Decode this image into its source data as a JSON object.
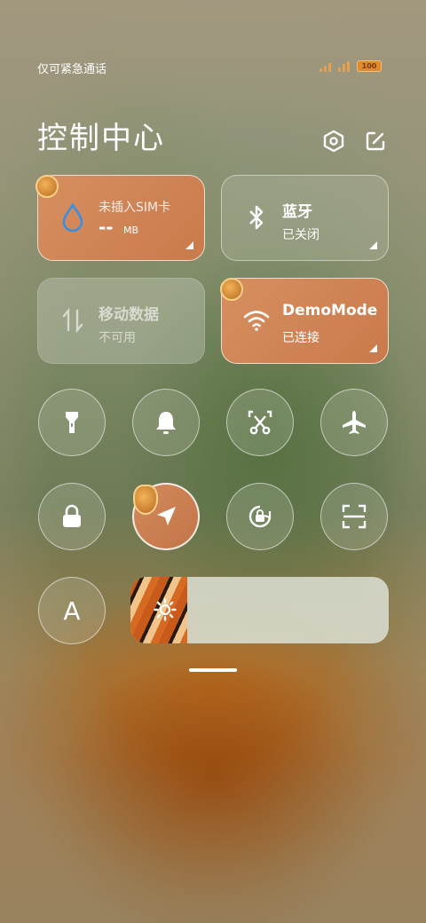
{
  "status_bar": {
    "carrier_text": "仅可紧急通话",
    "battery_label": "100"
  },
  "header": {
    "title": "控制中心",
    "settings_icon": "hexagon-settings-icon",
    "edit_icon": "edit-square-icon"
  },
  "tiles": {
    "data_usage": {
      "name": "未插入SIM卡",
      "value": "--",
      "unit": "MB",
      "icon": "water-drop-icon"
    },
    "bluetooth": {
      "name": "蓝牙",
      "status": "已关闭",
      "icon": "bluetooth-icon"
    },
    "mobile_data": {
      "name": "移动数据",
      "status": "不可用",
      "icon": "data-arrows-icon"
    },
    "wifi": {
      "name": "DemoMode",
      "status": "已连接",
      "icon": "wifi-icon"
    }
  },
  "toggles": [
    {
      "name": "flashlight",
      "icon": "flashlight-icon",
      "active": false
    },
    {
      "name": "ringer",
      "icon": "bell-icon",
      "active": false
    },
    {
      "name": "screenshot",
      "icon": "scissors-icon",
      "active": false
    },
    {
      "name": "airplane-mode",
      "icon": "airplane-icon",
      "active": false
    },
    {
      "name": "lock-screen",
      "icon": "lock-icon",
      "active": false
    },
    {
      "name": "location",
      "icon": "location-arrow-icon",
      "active": true
    },
    {
      "name": "rotation-lock",
      "icon": "rotation-lock-icon",
      "active": false
    },
    {
      "name": "scan",
      "icon": "scan-icon",
      "active": false
    },
    {
      "name": "auto-brightness",
      "icon": "letter-a-icon",
      "label": "A",
      "active": false
    }
  ],
  "brightness": {
    "level": 0.22,
    "icon": "sun-icon"
  },
  "colors": {
    "accent_orange": "#cd8152",
    "battery": "#e08a30"
  }
}
